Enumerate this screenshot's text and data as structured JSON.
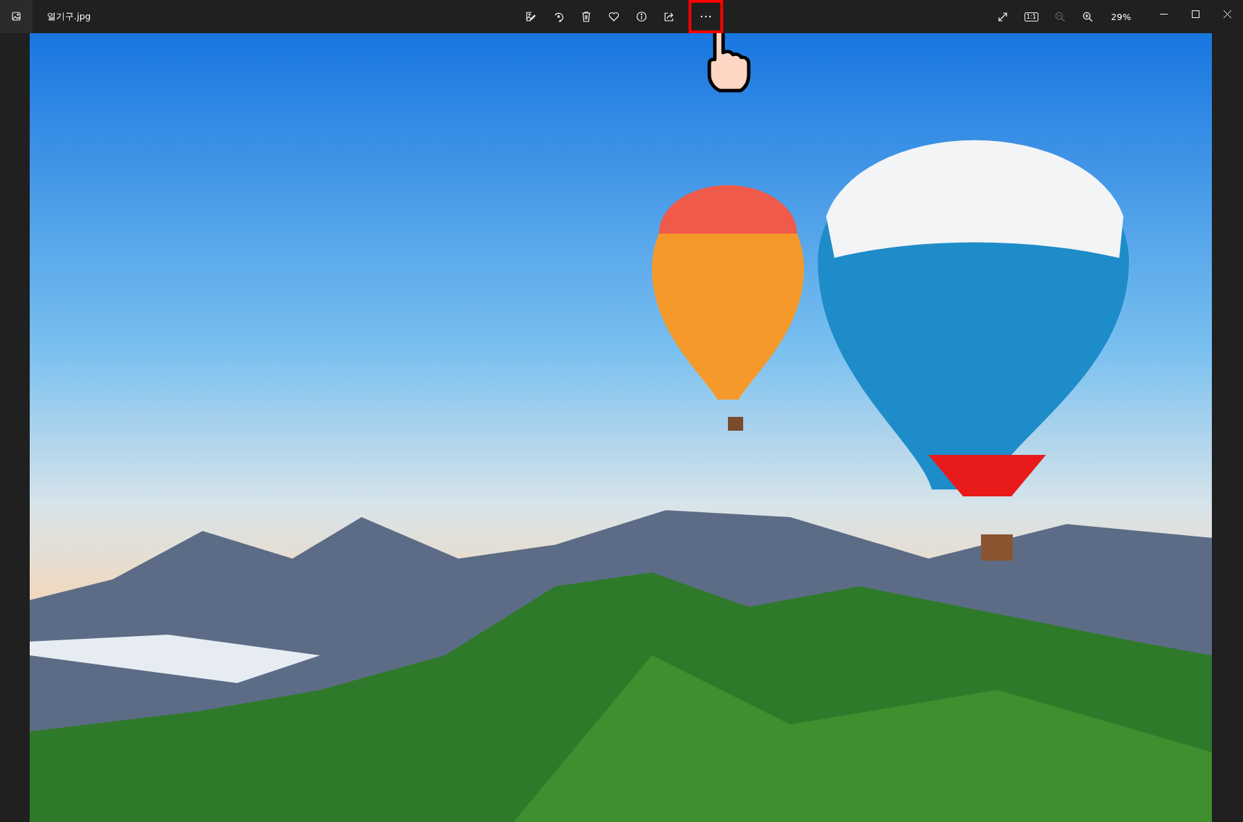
{
  "window": {
    "file_name": "열기구.jpg",
    "zoom_level": "29%"
  },
  "toolbar": [
    {
      "kind": "edit",
      "highlighted": false
    },
    {
      "kind": "rotate",
      "highlighted": false
    },
    {
      "kind": "delete",
      "highlighted": false
    },
    {
      "kind": "favorite",
      "highlighted": false
    },
    {
      "kind": "info",
      "highlighted": false
    },
    {
      "kind": "share",
      "highlighted": false
    },
    {
      "kind": "more",
      "highlighted": true
    }
  ],
  "view_controls": [
    {
      "kind": "fullscreen",
      "disabled": false
    },
    {
      "kind": "actual_size",
      "label": "1:1",
      "disabled": false
    },
    {
      "kind": "zoom_out",
      "disabled": true
    },
    {
      "kind": "zoom_in",
      "disabled": false
    }
  ]
}
